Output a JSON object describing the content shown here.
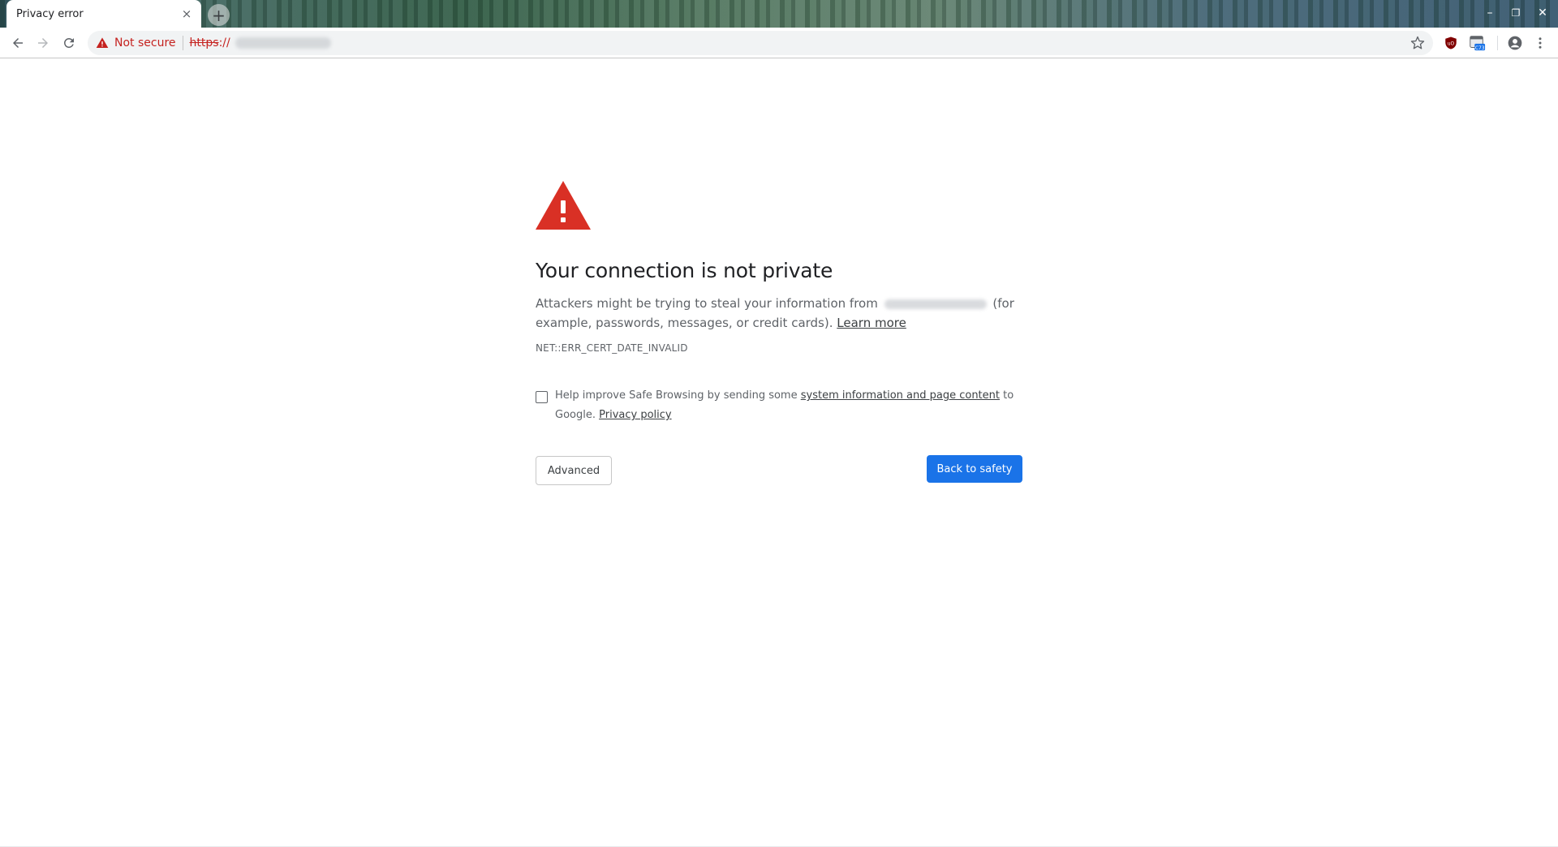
{
  "browser": {
    "tab": {
      "title": "Privacy error",
      "close_glyph": "×"
    },
    "new_tab_glyph": "+",
    "window_controls": {
      "minimize": "–",
      "restore": "❐",
      "close": "✕"
    },
    "omnibox": {
      "security_label": "Not secure",
      "scheme": "https",
      "scheme_sep": "://",
      "host_hidden": true
    },
    "icons": [
      "back-icon",
      "forward-icon",
      "reload-icon",
      "warning-icon",
      "star-icon",
      "ublock-icon",
      "calendar-extension-icon",
      "account-icon",
      "kebab-menu-icon"
    ],
    "extension_badge": "C73"
  },
  "interstitial": {
    "heading": "Your connection is not private",
    "explanation": {
      "before_host": "Attackers might be trying to steal your information from",
      "after_host": "(for example, passwords, messages, or credit cards).",
      "learn_more": "Learn more"
    },
    "error_code": "NET::ERR_CERT_DATE_INVALID",
    "safe_browsing": {
      "checked": false,
      "text_before": "Help improve Safe Browsing by sending some",
      "link": "system information and page content",
      "text_after": "to Google.",
      "privacy_link": "Privacy policy"
    },
    "buttons": {
      "advanced": "Advanced",
      "back": "Back to safety"
    },
    "colors": {
      "warning_red": "#d93025",
      "primary_blue": "#1a73e8"
    }
  }
}
